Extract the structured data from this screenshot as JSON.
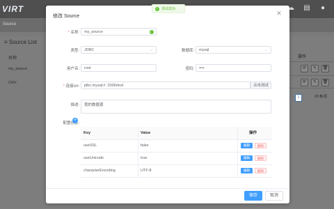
{
  "app": {
    "logo": "VIRT"
  },
  "background": {
    "breadcrumb": "Source",
    "panel_title": "Source List",
    "column_name": "名称",
    "column_op": "操作",
    "rows": [
      "my_source",
      "CRV"
    ],
    "pager_current": "1",
    "page_size": "20 条/页"
  },
  "toast": {
    "text": "测试成功"
  },
  "dialog": {
    "title": "修改 Source",
    "name_label": "名称:",
    "name_value": "my_source",
    "type_label": "类型:",
    "type_value": "JDBC",
    "db_label": "数据库:",
    "db_value": "mysql",
    "user_label": "用户名:",
    "user_value": "root",
    "password_label": "密码:",
    "password_value": "••••",
    "url_label": "连接Url:",
    "url_value": "jdbc:mysql://              :3306/test",
    "test_button": "点击测试",
    "desc_label": "描述:",
    "desc_value": "我的数据源",
    "config_label": "配置信息:",
    "table": {
      "headers": {
        "key": "Key",
        "value": "Value",
        "op": "操作"
      },
      "rows": [
        {
          "key": "useSSL",
          "value": "false"
        },
        {
          "key": "useUnicode",
          "value": "true"
        },
        {
          "key": "characterEncoding",
          "value": "UTF-8"
        }
      ],
      "edit_label": "编辑",
      "delete_label": "删除"
    },
    "save_button": "保存",
    "cancel_button": "取消"
  }
}
